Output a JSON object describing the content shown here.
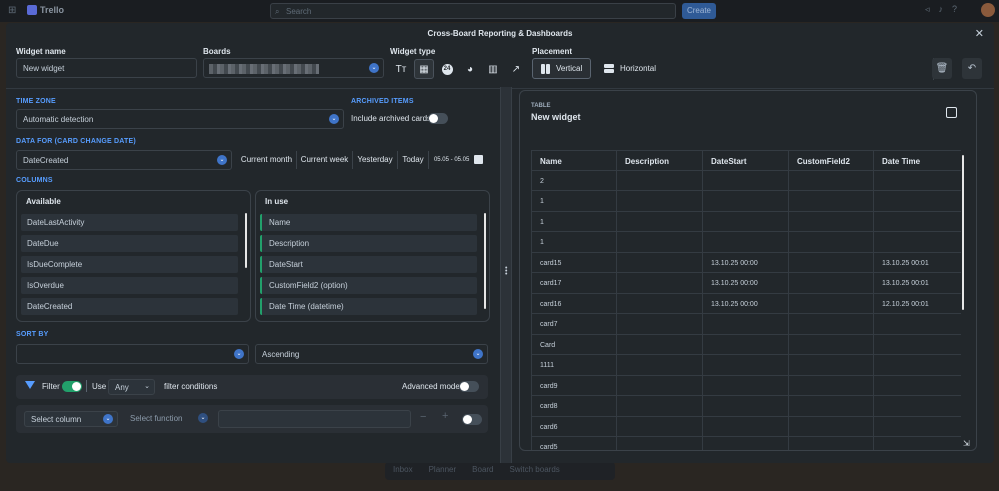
{
  "topbar": {
    "app_name": "Trello",
    "search_placeholder": "Search",
    "create_label": "Create"
  },
  "bottom_nav": {
    "inbox": "Inbox",
    "planner": "Planner",
    "board": "Board",
    "switch": "Switch boards"
  },
  "modal": {
    "title": "Cross-Board Reporting & Dashboards",
    "widget_name_label": "Widget name",
    "widget_name_value": "New widget",
    "boards_label": "Boards",
    "widget_type_label": "Widget type",
    "placement_label": "Placement",
    "placement_vertical": "Vertical",
    "placement_horizontal": "Horizontal"
  },
  "settings": {
    "time_zone_title": "TIME ZONE",
    "time_zone_value": "Automatic detection",
    "archived_title": "ARCHIVED ITEMS",
    "archived_label": "Include archived cards",
    "data_for_title": "DATA FOR (CARD CHANGE DATE)",
    "data_for_value": "DateCreated",
    "chips": [
      "Current month",
      "Current week",
      "Yesterday",
      "Today"
    ],
    "date_range": "05.05 - 05.05",
    "columns_title": "COLUMNS",
    "available_label": "Available",
    "available_items": [
      "DateLastActivity",
      "DateDue",
      "IsDueComplete",
      "IsOverdue",
      "DateCreated"
    ],
    "inuse_label": "In use",
    "inuse_items": [
      "Name",
      "Description",
      "DateStart",
      "CustomField2 (option)",
      "Date Time (datetime)"
    ],
    "sort_title": "SORT BY",
    "sort_value": "",
    "sort_order": "Ascending",
    "filter_label": "Filter",
    "use_label": "Use",
    "any_value": "Any",
    "filter_conditions": "filter conditions",
    "advanced_label": "Advanced mode",
    "select_column": "Select column",
    "select_function": "Select function",
    "minus": "−",
    "plus": "+"
  },
  "preview": {
    "kind": "TABLE",
    "title": "New widget",
    "columns": [
      "Name",
      "Description",
      "DateStart",
      "CustomField2",
      "Date Time"
    ],
    "rows": [
      [
        "2",
        "",
        "",
        "",
        ""
      ],
      [
        "1",
        "",
        "",
        "",
        ""
      ],
      [
        "1",
        "",
        "",
        "",
        ""
      ],
      [
        "1",
        "",
        "",
        "",
        ""
      ],
      [
        "card15",
        "",
        "13.10.25 00:00",
        "",
        "13.10.25 00:01"
      ],
      [
        "card17",
        "",
        "13.10.25 00:00",
        "",
        "13.10.25 00:01"
      ],
      [
        "card16",
        "",
        "13.10.25 00:00",
        "",
        "12.10.25 00:01"
      ],
      [
        "card7",
        "",
        "",
        "",
        ""
      ],
      [
        "Card",
        "",
        "",
        "",
        ""
      ],
      [
        "1111",
        "",
        "",
        "",
        ""
      ],
      [
        "card9",
        "",
        "",
        "",
        ""
      ],
      [
        "card8",
        "",
        "",
        "",
        ""
      ],
      [
        "card6",
        "",
        "",
        "",
        ""
      ],
      [
        "card5",
        "",
        "",
        "",
        ""
      ]
    ]
  },
  "colors": {
    "accent": "#579dff",
    "toggle_on": "#22a06b",
    "modal_bg": "#22272b"
  }
}
